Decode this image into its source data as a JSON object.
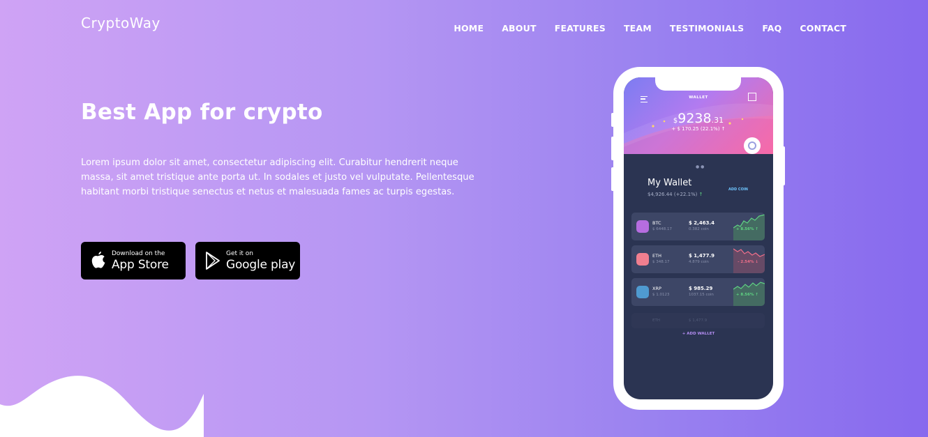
{
  "brand": "CryptoWay",
  "nav": [
    "HOME",
    "ABOUT",
    "FEATURES",
    "TEAM",
    "TESTIMONIALS",
    "FAQ",
    "CONTACT"
  ],
  "hero": {
    "title": "Best App for crypto",
    "description": "Lorem ipsum dolor sit amet, consectetur adipiscing elit. Curabitur hendrerit neque massa, sit amet tristique ante porta ut. In sodales et justo vel vulputate. Pellentesque habitant morbi tristique senectus et netus et malesuada fames ac turpis egestas."
  },
  "buttons": {
    "appstore": {
      "small": "Download on the",
      "big": "App Store"
    },
    "googleplay": {
      "small": "Get it on",
      "big": "Google play"
    }
  },
  "phone": {
    "header": "WALLET",
    "balance_currency": "$",
    "balance_main": "9238",
    "balance_dec": ".31",
    "change": "+ $ 170.25 (22.1%) ↑",
    "wallet_title": "My Wallet",
    "wallet_value": "$4,926.44 (+22.1%)",
    "wallet_arrow": "↑",
    "add_coin": "ADD COIN",
    "add_wallet": "+ ADD WALLET",
    "coins": [
      {
        "symbol": "BTC",
        "sub": "$ 6448.17",
        "value": "$ 2,463.4",
        "amount": "0.382 coin",
        "pct": "+ 8.56% ↑",
        "color": "#b66de0",
        "up": true
      },
      {
        "symbol": "ETH",
        "sub": "$ 348.17",
        "value": "$ 1,477.9",
        "amount": "4.879 coin",
        "pct": "- 2.54% ↓",
        "color": "#f07f8f",
        "up": false
      },
      {
        "symbol": "XRP",
        "sub": "$ 1.0123",
        "value": "$ 985.29",
        "amount": "1037.15 coin",
        "pct": "+ 8.56% ↑",
        "color": "#4f9ad0",
        "up": true
      }
    ],
    "faded": {
      "symbol": "ETH",
      "value": "$ 1,477.9"
    }
  },
  "colors": {
    "up": "#5fd383",
    "down": "#f06f8a"
  }
}
